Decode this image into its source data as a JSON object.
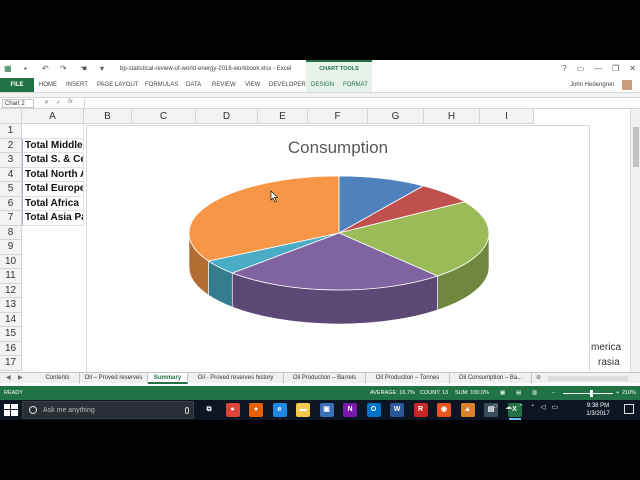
{
  "titlebar": {
    "doc_title": "bp-statistical-review-of-world-energy-2016-workbook.xlsx - Excel",
    "context_group": "CHART TOOLS",
    "window_controls": [
      "?",
      "▭",
      "—",
      "❐",
      "✕"
    ]
  },
  "ribbon": {
    "file": "FILE",
    "tabs": [
      "HOME",
      "INSERT",
      "PAGE LAYOUT",
      "FORMULAS",
      "DATA",
      "REVIEW",
      "VIEW",
      "DEVELOPER"
    ],
    "context_tabs": [
      "DESIGN",
      "FORMAT"
    ],
    "user": "John Hedengren"
  },
  "formulabar": {
    "namebox": "Chart 2",
    "icons": [
      "✕",
      "✓",
      "fx"
    ],
    "value": ""
  },
  "grid": {
    "columns": [
      "A",
      "B",
      "C",
      "D",
      "E",
      "F",
      "G",
      "H",
      "I"
    ],
    "rows": [
      "1",
      "2",
      "3",
      "4",
      "5",
      "6",
      "7",
      "8",
      "9",
      "10",
      "11",
      "12",
      "13",
      "14",
      "15",
      "16",
      "17"
    ],
    "cells_a": [
      "",
      "Total Middle East",
      "Total S. & Cent. America",
      "Total North America",
      "Total Europe & Eurasia",
      "Total Africa",
      "Total Asia Pacific"
    ],
    "offchart_a": "merica",
    "offchart_b": "rasia"
  },
  "chart_data": {
    "type": "pie",
    "title": "Consumption",
    "three_d": true,
    "slices": [
      {
        "value": 9.5,
        "color": "#4f81bd"
      },
      {
        "value": 6.3,
        "color": "#c0504d"
      },
      {
        "value": 22.8,
        "color": "#9bbb59"
      },
      {
        "value": 24.0,
        "color": "#8064a2"
      },
      {
        "value": 4.2,
        "color": "#4bacc6"
      },
      {
        "value": 33.2,
        "color": "#f79646"
      }
    ]
  },
  "sheets": {
    "tabs": [
      "Contents",
      "Oil – Proved reserves",
      "Summary",
      "Oil - Proved reserves history",
      "Oil Production – Barrels",
      "Oil Production – Tonnes",
      "Oil Consumption – Ba..."
    ],
    "active_index": 2
  },
  "statusbar": {
    "ready": "READY",
    "average": "AVERAGE: 16.7%",
    "count": "COUNT: 13",
    "sum": "SUM: 100.0%",
    "zoom": "210%"
  },
  "taskbar": {
    "search_placeholder": "Ask me anything",
    "apps": [
      {
        "name": "task-view",
        "label": "⧉",
        "color": "#0b1622"
      },
      {
        "name": "chrome",
        "label": "●",
        "color": "#db4437"
      },
      {
        "name": "firefox",
        "label": "●",
        "color": "#e66000"
      },
      {
        "name": "edge",
        "label": "e",
        "color": "#1e88e5"
      },
      {
        "name": "file-explorer",
        "label": "▬",
        "color": "#f2c94c"
      },
      {
        "name": "store",
        "label": "▣",
        "color": "#3a6fb5"
      },
      {
        "name": "onenote",
        "label": "N",
        "color": "#7719aa"
      },
      {
        "name": "outlook",
        "label": "O",
        "color": "#0072c6"
      },
      {
        "name": "word",
        "label": "W",
        "color": "#2b579a"
      },
      {
        "name": "r-app",
        "label": "R",
        "color": "#c62828"
      },
      {
        "name": "ubuntu",
        "label": "◉",
        "color": "#e95420"
      },
      {
        "name": "matlab",
        "label": "▲",
        "color": "#d9822b"
      },
      {
        "name": "generic-app",
        "label": "▤",
        "color": "#3b4c5c"
      },
      {
        "name": "excel",
        "label": "X",
        "color": "#217346"
      }
    ],
    "time": "9:38 PM",
    "date": "1/3/2017"
  }
}
